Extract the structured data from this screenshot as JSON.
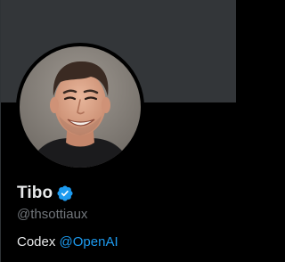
{
  "profile": {
    "display_name": "Tibo",
    "handle": "@thsottiaux",
    "bio_text": "Codex",
    "bio_mention": "@OpenAI",
    "verified": true
  },
  "colors": {
    "banner": "#333639",
    "background": "#000000",
    "name": "#e7e9ea",
    "handle": "#71767b",
    "link": "#1d9bf0",
    "verified_badge": "#1d9bf0"
  },
  "icons": {
    "verified": "verified-badge-icon",
    "avatar": "profile-photo"
  }
}
